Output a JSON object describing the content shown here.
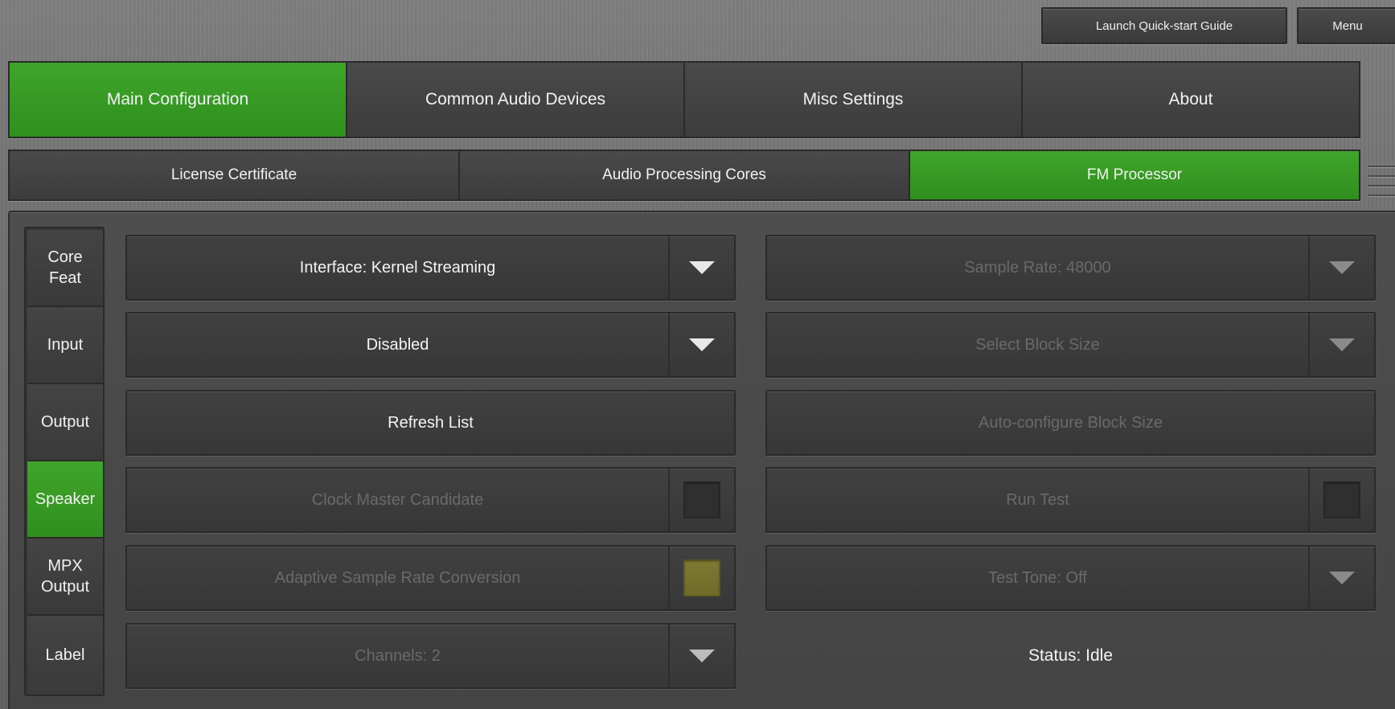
{
  "top_buttons": {
    "quickstart": "Launch Quick-start Guide",
    "menu": "Menu"
  },
  "main_tabs": [
    {
      "label": "Main Configuration",
      "active": true
    },
    {
      "label": "Common Audio Devices",
      "active": false
    },
    {
      "label": "Misc Settings",
      "active": false
    },
    {
      "label": "About",
      "active": false
    }
  ],
  "sub_tabs": [
    {
      "label": "License Certificate",
      "active": false
    },
    {
      "label": "Audio Processing Cores",
      "active": false
    },
    {
      "label": "FM Processor",
      "active": true
    }
  ],
  "side_nav": [
    {
      "label": "Core\nFeat",
      "active": false
    },
    {
      "label": "Input",
      "active": false
    },
    {
      "label": "Output",
      "active": false
    },
    {
      "label": "Speaker",
      "active": true
    },
    {
      "label": "MPX\nOutput",
      "active": false
    },
    {
      "label": "Label",
      "active": false
    }
  ],
  "left_controls": {
    "interface": "Interface: Kernel Streaming",
    "device": "Disabled",
    "refresh": "Refresh List",
    "clock_master": "Clock Master Candidate",
    "asrc": "Adaptive Sample Rate Conversion",
    "channels": "Channels: 2"
  },
  "right_controls": {
    "sample_rate": "Sample Rate: 48000",
    "block_size": "Select Block Size",
    "auto_block": "Auto-configure Block Size",
    "run_test": "Run Test",
    "test_tone": "Test Tone: Off",
    "status": "Status: Idle"
  },
  "colors": {
    "active_green": "#37991f",
    "asrc_checkbox": "#7d7a32"
  }
}
